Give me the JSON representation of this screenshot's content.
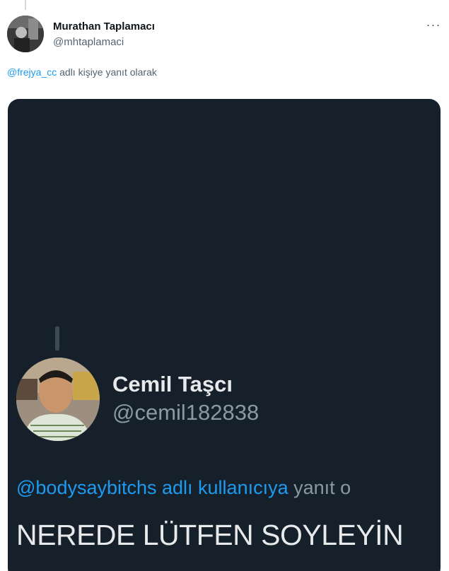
{
  "tweet": {
    "author_name": "Murathan Taplamacı",
    "author_handle": "@mhtaplamaci",
    "more_label": "···",
    "reply_mention": "@frejya_cc",
    "reply_text": " adlı kişiye yanıt olarak"
  },
  "media": {
    "name": "Cemil Taşcı",
    "handle": "@cemil182838",
    "reply_mention": "@bodysaybitchs adlı kullanıcıya",
    "reply_text": " yanıt o",
    "body": "NEREDE LÜTFEN SOYLEYİN"
  }
}
